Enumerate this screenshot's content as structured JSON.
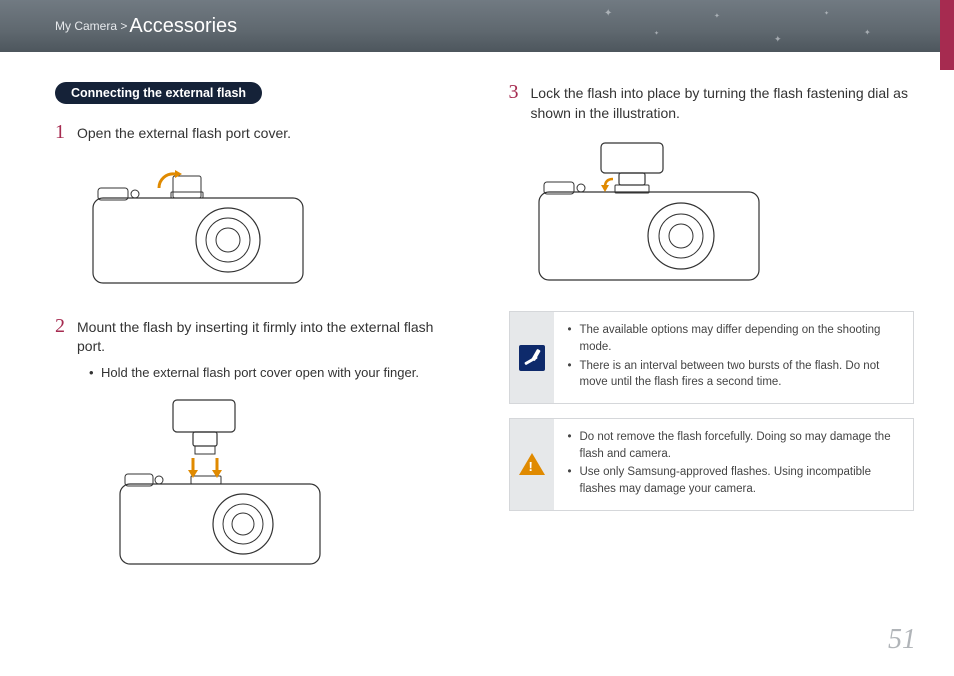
{
  "breadcrumb": {
    "parent": "My Camera >",
    "current": "Accessories"
  },
  "section_title": "Connecting the external flash",
  "steps": {
    "1": {
      "num": "1",
      "text": "Open the external flash port cover."
    },
    "2": {
      "num": "2",
      "text": "Mount the flash by inserting it firmly into the external flash port.",
      "sub": "Hold the external flash port cover open with your finger."
    },
    "3": {
      "num": "3",
      "text": "Lock the flash into place by turning the flash fastening dial as shown in the illustration."
    }
  },
  "note_info": {
    "items": [
      "The available options may differ depending on the shooting mode.",
      "There is an interval between two bursts of the flash. Do not move until the flash fires a second time."
    ]
  },
  "note_warn": {
    "items": [
      "Do not remove the flash forcefully. Doing so may damage the flash and camera.",
      "Use only Samsung-approved flashes. Using incompatible flashes may damage your camera."
    ]
  },
  "page_number": "51"
}
